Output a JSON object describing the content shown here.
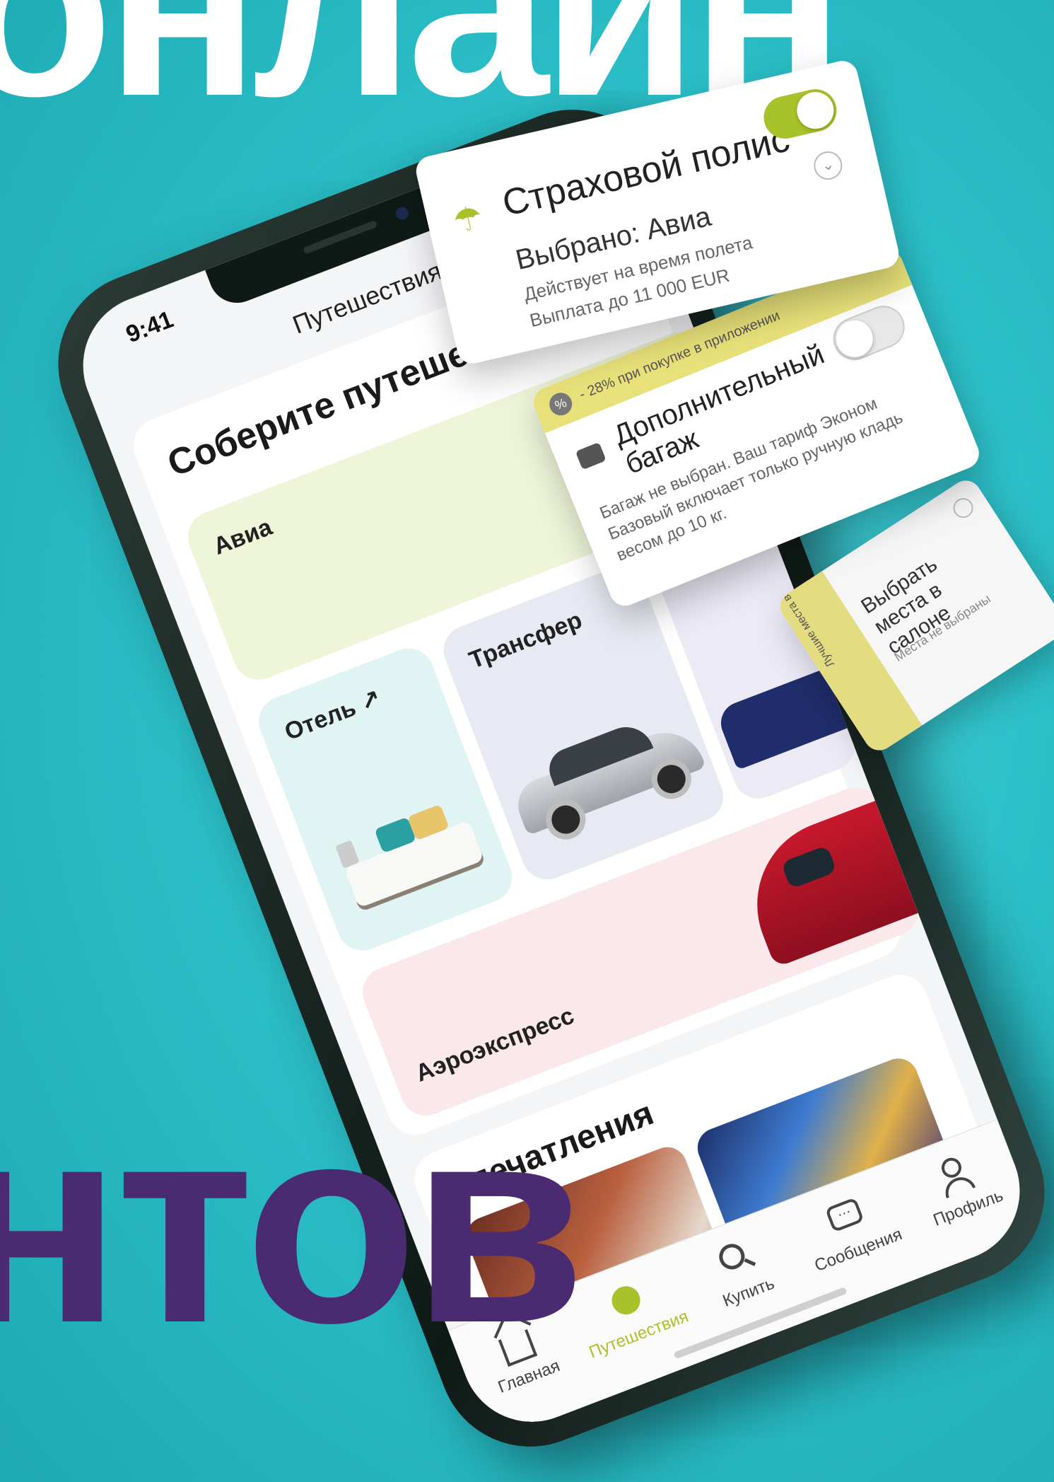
{
  "background": {
    "top_word": "онлайн",
    "bottom_word": "нтов",
    "colors": {
      "background": "#2cc0c9",
      "bottom_word": "#4a2a70",
      "accent": "#a7c22a"
    }
  },
  "status_bar": {
    "time": "9:41"
  },
  "nav": {
    "title": "Путешествия"
  },
  "assemble": {
    "title": "Соберите путешествие",
    "tiles": {
      "avia": "Авиа",
      "hotel": "Отель ↗",
      "transfer": "Трансфер",
      "aeroexpress": "Аэроэкспресс"
    }
  },
  "impressions": {
    "title": "Впечатления"
  },
  "tabbar": {
    "items": [
      {
        "label": "Главная",
        "icon": "home-icon"
      },
      {
        "label": "Путешествия",
        "icon": "travel-icon",
        "active": true
      },
      {
        "label": "Купить",
        "icon": "search-icon"
      },
      {
        "label": "Сообщения",
        "icon": "message-icon"
      },
      {
        "label": "Профиль",
        "icon": "profile-icon"
      }
    ]
  },
  "insurance_card": {
    "title": "Страховой полис",
    "selected": "Выбрано: Авиа",
    "line1": "Действует на время полета",
    "line2": "Выплата до 11 000 EUR",
    "toggle_on": true,
    "icon": "umbrella-icon"
  },
  "baggage_card": {
    "promo": "- 28% при покупке в приложении",
    "title": "Дополнительный багаж",
    "description": "Багаж не выбран. Ваш тариф Эконом Базовый включает только ручную кладь весом до 10 кг.",
    "toggle_on": false,
    "icon": "suitcase-icon"
  },
  "seat_card": {
    "promo": "Лучшие места в салоне",
    "title": "Выбрать места в салоне",
    "subtitle": "Места не выбраны"
  }
}
